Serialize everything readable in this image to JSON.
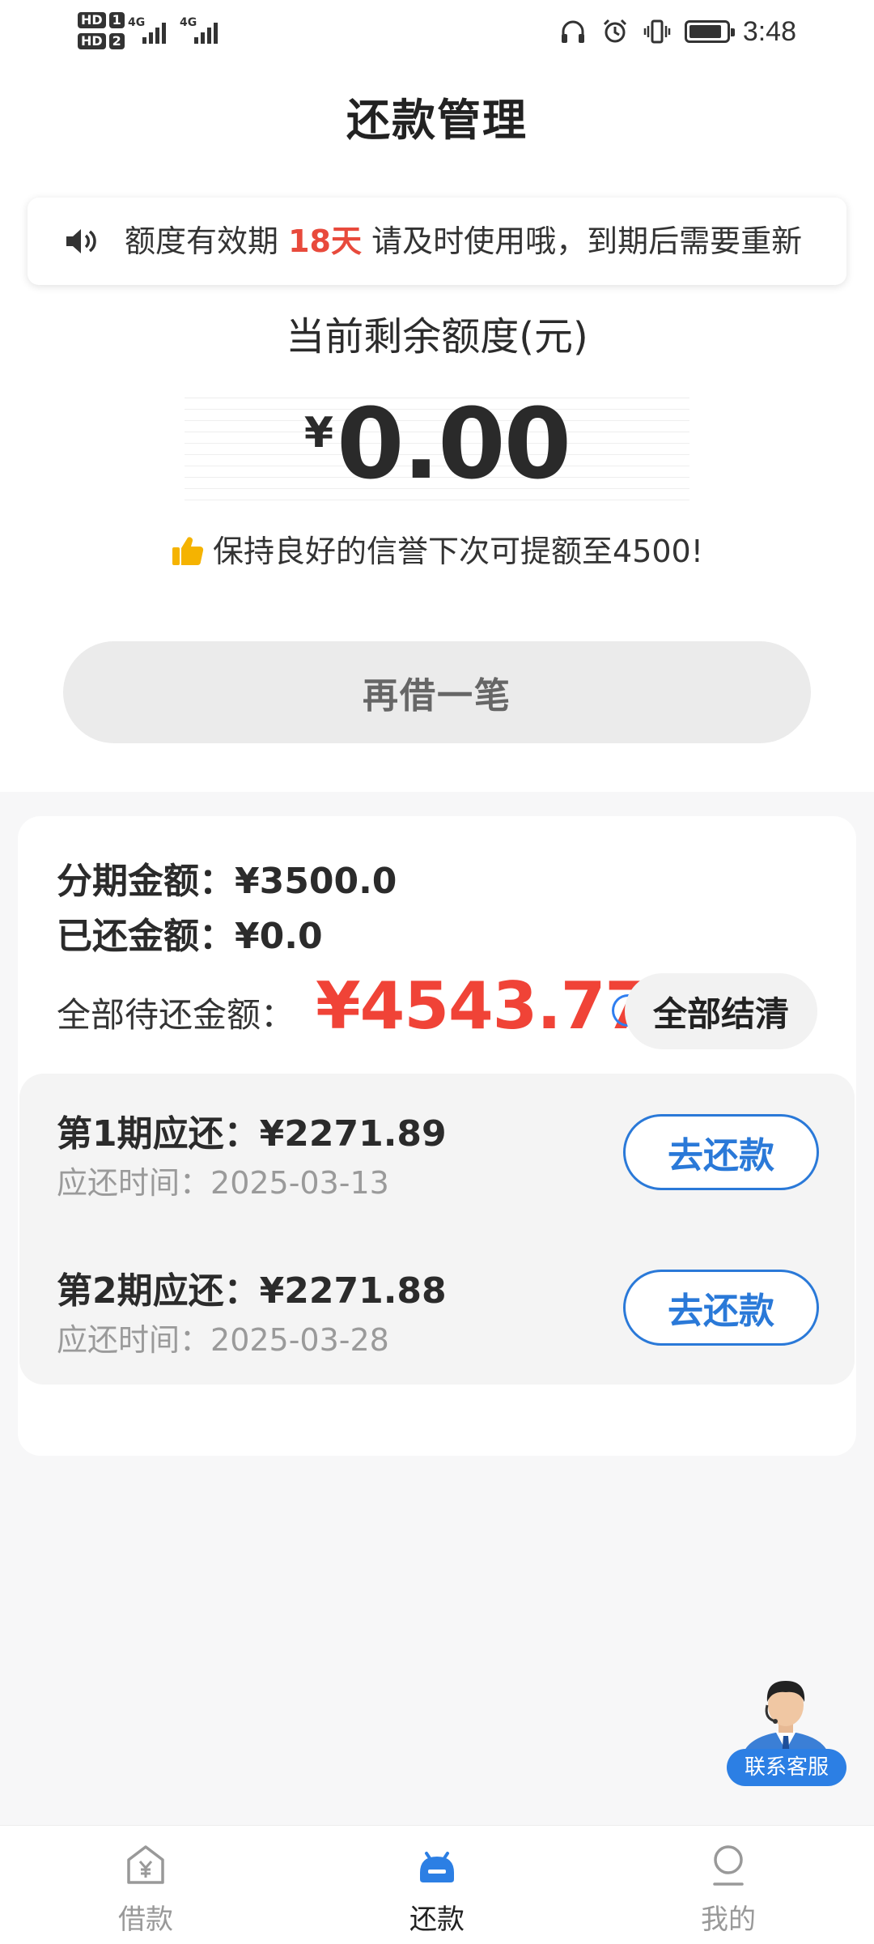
{
  "status_bar": {
    "sim1_label": "HD",
    "sim1_index": "1",
    "sim2_label": "HD",
    "sim2_index": "2",
    "network1": "4G",
    "network2": "4G",
    "icons": [
      "headphones-icon",
      "alarm-icon",
      "vibrate-icon",
      "battery-icon"
    ],
    "time": "3:48"
  },
  "header": {
    "title": "还款管理"
  },
  "notice": {
    "icon": "speaker-icon",
    "prefix": "额度有效期 ",
    "highlight": "18天",
    "suffix": " 请及时使用哦，到期后需要重新",
    "highlight_color": "#e84a3c"
  },
  "quota": {
    "label": "当前剩余额度(元)",
    "currency": "¥",
    "amount": "0.00",
    "tip": "保持良好的信誉下次可提额至4500!",
    "tip_icon": "thumbs-up-icon"
  },
  "borrow_button": {
    "label": "再借一笔"
  },
  "summary": {
    "installment_label": "分期金额：",
    "installment_amount": "¥3500.0",
    "repaid_label": "已还金额：",
    "repaid_amount": "¥0.0",
    "total_label": "全部待还金额：",
    "total_amount": "¥4543.77",
    "total_color": "#f04337",
    "payoff_button": "全部结清"
  },
  "installments": [
    {
      "title": "第1期应还：",
      "amount": "¥2271.89",
      "due_label": "应还时间：",
      "due_date": "2025-03-13",
      "button": "去还款"
    },
    {
      "title": "第2期应还：",
      "amount": "¥2271.88",
      "due_label": "应还时间：",
      "due_date": "2025-03-28",
      "button": "去还款"
    }
  ],
  "customer_service": {
    "label": "联系客服",
    "icon": "agent-avatar-icon"
  },
  "tabs": [
    {
      "label": "借款",
      "icon": "loan-icon",
      "active": false
    },
    {
      "label": "还款",
      "icon": "repay-icon",
      "active": true
    },
    {
      "label": "我的",
      "icon": "profile-icon",
      "active": false
    }
  ],
  "colors": {
    "accent": "#2a79d8",
    "alert": "#f04337",
    "active_tab": "#2c7fe4"
  }
}
